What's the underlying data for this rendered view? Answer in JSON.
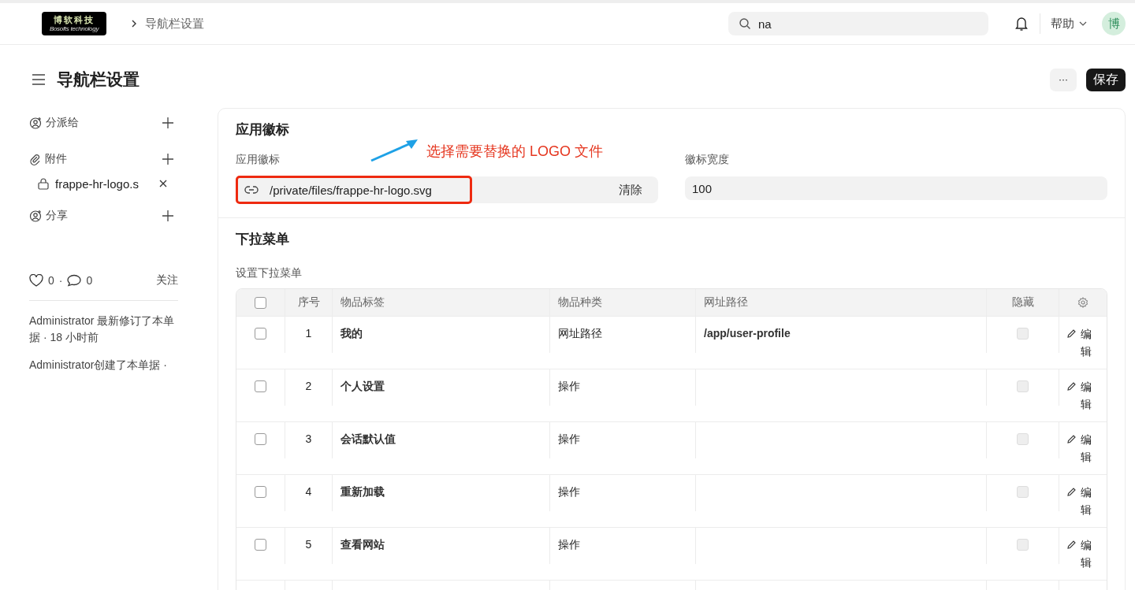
{
  "topbar": {
    "logo": {
      "title": "博软科技",
      "subtitle": "Bosofts technology"
    },
    "breadcrumb": "导航栏设置",
    "search": {
      "value": "na"
    },
    "help": "帮助",
    "avatar": "博"
  },
  "header": {
    "title": "导航栏设置",
    "more": "···",
    "save": "保存"
  },
  "sidebar": {
    "sections": [
      {
        "kind": "assign",
        "label": "分派给"
      },
      {
        "kind": "attach",
        "label": "附件",
        "attachments": [
          "frappe-hr-logo.s"
        ]
      },
      {
        "kind": "share",
        "label": "分享"
      }
    ],
    "likes": "0",
    "separator": "·",
    "comments": "0",
    "follow": "关注",
    "activity": [
      "Administrator 最新修订了本单据 · 18 小时前",
      "Administrator创建了本单据 ·"
    ]
  },
  "logo_section": {
    "title": "应用徽标",
    "logo_field": {
      "label": "应用徽标",
      "value": "/private/files/frappe-hr-logo.svg",
      "clear": "清除"
    },
    "width_field": {
      "label": "徽标宽度",
      "value": "100"
    },
    "annotation": {
      "text": "选择需要替换的 LOGO 文件"
    }
  },
  "dropdown_section": {
    "title": "下拉菜单",
    "table_label": "设置下拉菜单",
    "all_selected": false,
    "columns": [
      "序号",
      "物品标签",
      "物品种类",
      "网址路径",
      "隐藏"
    ],
    "rows": [
      {
        "no": "1",
        "label": "我的",
        "type": "网址路径",
        "url": "/app/user-profile",
        "selected": false,
        "hidden": false,
        "edit": "编辑"
      },
      {
        "no": "2",
        "label": "个人设置",
        "type": "操作",
        "selected": false,
        "hidden": false,
        "edit": "编辑"
      },
      {
        "no": "3",
        "label": "会话默认值",
        "type": "操作",
        "selected": false,
        "hidden": false,
        "edit": "编辑"
      },
      {
        "no": "4",
        "label": "重新加载",
        "type": "操作",
        "selected": false,
        "hidden": false,
        "edit": "编辑"
      },
      {
        "no": "5",
        "label": "查看网站",
        "type": "操作",
        "selected": false,
        "hidden": false,
        "edit": "编辑"
      }
    ]
  }
}
